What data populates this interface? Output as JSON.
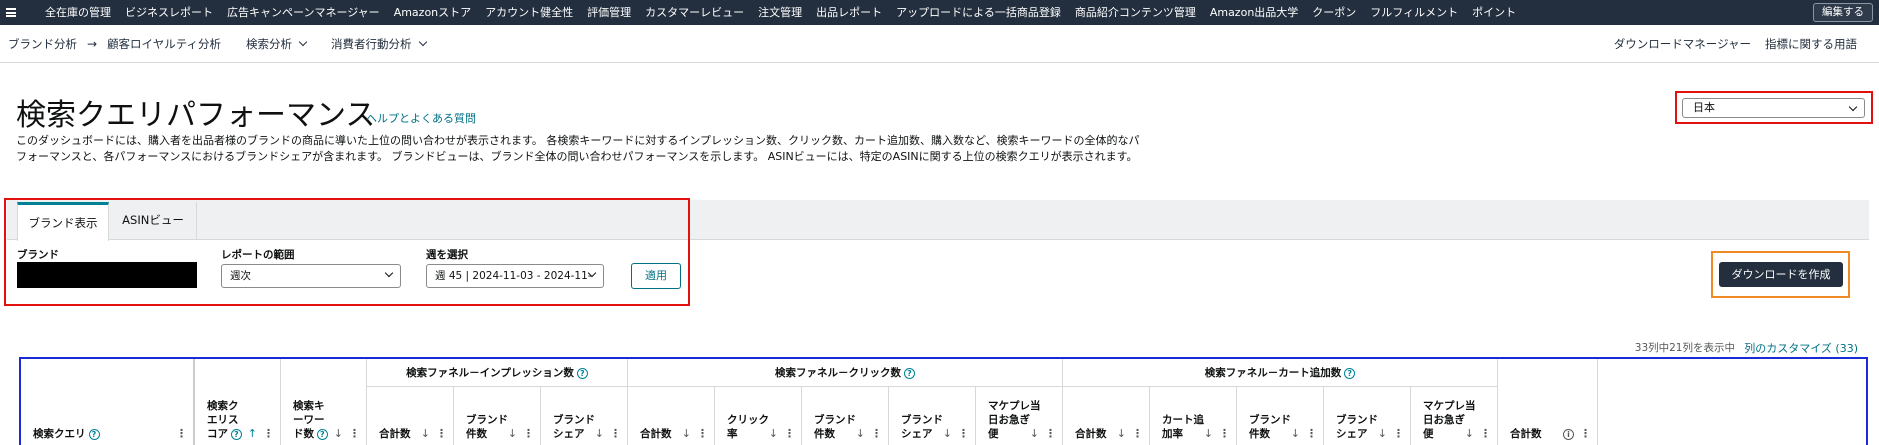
{
  "topnav": {
    "items": [
      "全在庫の管理",
      "ビジネスレポート",
      "広告キャンペーンマネージャー",
      "Amazonストア",
      "アカウント健全性",
      "評価管理",
      "カスタマーレビュー",
      "注文管理",
      "出品レポート",
      "アップロードによる一括商品登録",
      "商品紹介コンテンツ管理",
      "Amazon出品大学",
      "クーポン",
      "フルフィルメント",
      "ポイント"
    ],
    "edit_label": "編集する"
  },
  "subnav": {
    "breadcrumb_parent": "ブランド分析",
    "breadcrumb_arrow": "→",
    "items": [
      "顧客ロイヤルティ分析",
      "検索分析",
      "消費者行動分析"
    ],
    "download_manager": "ダウンロードマネージャー",
    "glossary": "指標に関する用語"
  },
  "header": {
    "title": "検索クエリパフォーマンス",
    "help_link": "ヘルプとよくある質問",
    "description": "このダッシュボードには、購入者を出品者様のブランドの商品に導いた上位の問い合わせが表示されます。 各検索キーワードに対するインプレッション数、クリック数、カート追加数、購入数など、検索キーワードの全体的なパフォーマンスと、各パフォーマンスにおけるブランドシェアが含まれます。 ブランドビューは、ブランド全体の問い合わせパフォーマンスを示します。 ASINビューには、特定のASINに関する上位の検索クエリが表示されます。",
    "marketplace": "日本"
  },
  "filters": {
    "tabs": [
      "ブランド表示",
      "ASINビュー"
    ],
    "brand_label": "ブランド",
    "range_label": "レポートの範囲",
    "range_value": "週次",
    "week_label": "週を選択",
    "week_value": "週 45 | 2024-11-03 - 2024-11-",
    "apply_label": "適用",
    "download_label": "ダウンロードを作成"
  },
  "table": {
    "column_info": "33列中21列を表示中",
    "customize_link": "列のカスタマイズ (33)",
    "groups": [
      "検索ファネル－インプレッション数",
      "検索ファネル－クリック数",
      "検索ファネル－カート追加数"
    ],
    "columns": [
      {
        "label": "検索クエリ"
      },
      {
        "label": "検索ク\nエリス\nコア"
      },
      {
        "label": "検索キ\nーワー\nド数"
      },
      {
        "label": "合計数"
      },
      {
        "label": "ブランド\n件数"
      },
      {
        "label": "ブランド\nシェア"
      },
      {
        "label": "合計数"
      },
      {
        "label": "クリック\n率"
      },
      {
        "label": "ブランド\n件数"
      },
      {
        "label": "ブランド\nシェア"
      },
      {
        "label": "マケプレ当\n日お急ぎ\n便"
      },
      {
        "label": "合計数"
      },
      {
        "label": "カート追\n加率"
      },
      {
        "label": "ブランド\n件数"
      },
      {
        "label": "ブランド\nシェア"
      },
      {
        "label": "マケプレ当\n日お急ぎ\n便"
      },
      {
        "label": "合計数"
      }
    ],
    "icons": {
      "help": "?",
      "info": "i",
      "sort_down": "↓",
      "sort_up": "↑",
      "menu": "⋮"
    }
  },
  "colors": {
    "nav_bg": "#232f3e",
    "link": "#007185",
    "red_frame": "#e3110e",
    "orange_frame": "#f08a24",
    "blue_frame": "#1a2bd6"
  }
}
